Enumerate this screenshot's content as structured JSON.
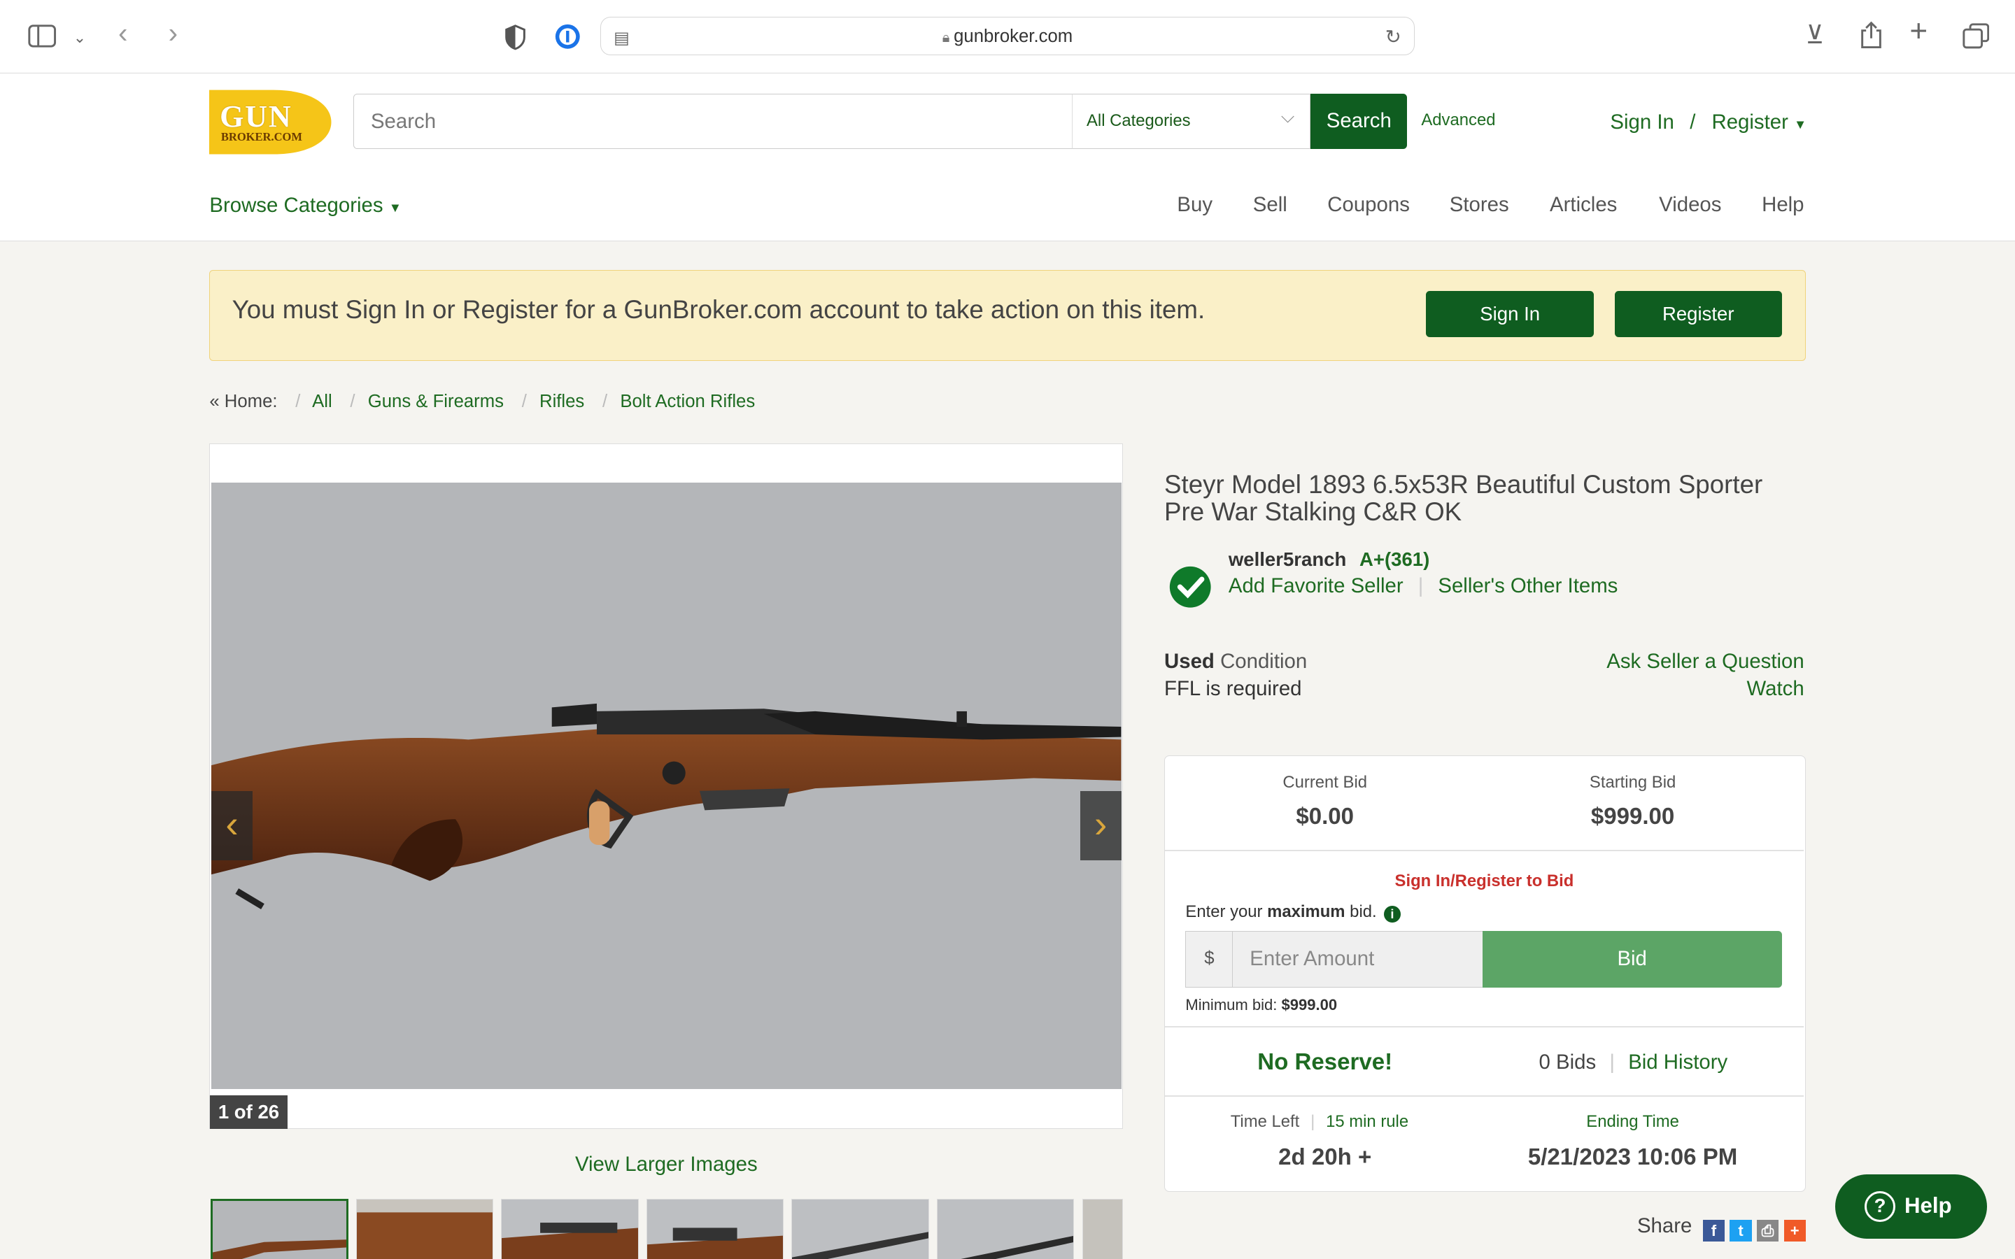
{
  "browser": {
    "url": "gunbroker.com"
  },
  "header": {
    "logo_line1": "GUN",
    "logo_line2": "BROKER.COM",
    "search_placeholder": "Search",
    "category": "All Categories",
    "search_button": "Search",
    "advanced": "Advanced",
    "sign_in": "Sign In",
    "slash": "/",
    "register": "Register"
  },
  "nav": {
    "browse": "Browse Categories",
    "links": [
      "Buy",
      "Sell",
      "Coupons",
      "Stores",
      "Articles",
      "Videos",
      "Help"
    ]
  },
  "banner": {
    "message": "You must Sign In or Register for a GunBroker.com account to take action on this item.",
    "sign_in": "Sign In",
    "register": "Register"
  },
  "breadcrumb": {
    "home": "« Home:",
    "items": [
      "All",
      "Guns & Firearms",
      "Rifles",
      "Bolt Action Rifles"
    ],
    "sep": "/"
  },
  "gallery": {
    "counter": "1 of 26",
    "view_larger": "View Larger Images",
    "prev": "‹",
    "next": "›"
  },
  "listing": {
    "title": "Steyr Model 1893 6.5x53R Beautiful Custom Sporter Pre War Stalking C&R OK",
    "seller": "weller5ranch",
    "rating": "A+(361)",
    "add_favorite": "Add Favorite Seller",
    "other_items": "Seller's Other Items",
    "condition_bold": "Used",
    "condition": "Condition",
    "ffl": "FFL is required",
    "ask": "Ask Seller a Question",
    "watch": "Watch"
  },
  "bid": {
    "current_label": "Current Bid",
    "current": "$0.00",
    "starting_label": "Starting Bid",
    "starting": "$999.00",
    "signin_to_bid": "Sign In/Register to Bid",
    "enter_pre": "Enter your",
    "enter_bold": "maximum",
    "enter_post": "bid.",
    "currency": "$",
    "amount_placeholder": "Enter Amount",
    "bid_button": "Bid",
    "min_label": "Minimum bid:",
    "min_value": "$999.00",
    "no_reserve": "No Reserve!",
    "bids": "0 Bids",
    "history": "Bid History",
    "time_left_label": "Time Left",
    "rule": "15 min rule",
    "time_left": "2d 20h +",
    "ending_label": "Ending Time",
    "ending": "5/21/2023 10:06 PM"
  },
  "share": {
    "label": "Share"
  },
  "help": {
    "label": "Help"
  },
  "colors": {
    "brand_green": "#0f5d20",
    "link_green": "#1e6b22",
    "alert_red": "#c9302c",
    "logo_yellow": "#f5c518"
  }
}
